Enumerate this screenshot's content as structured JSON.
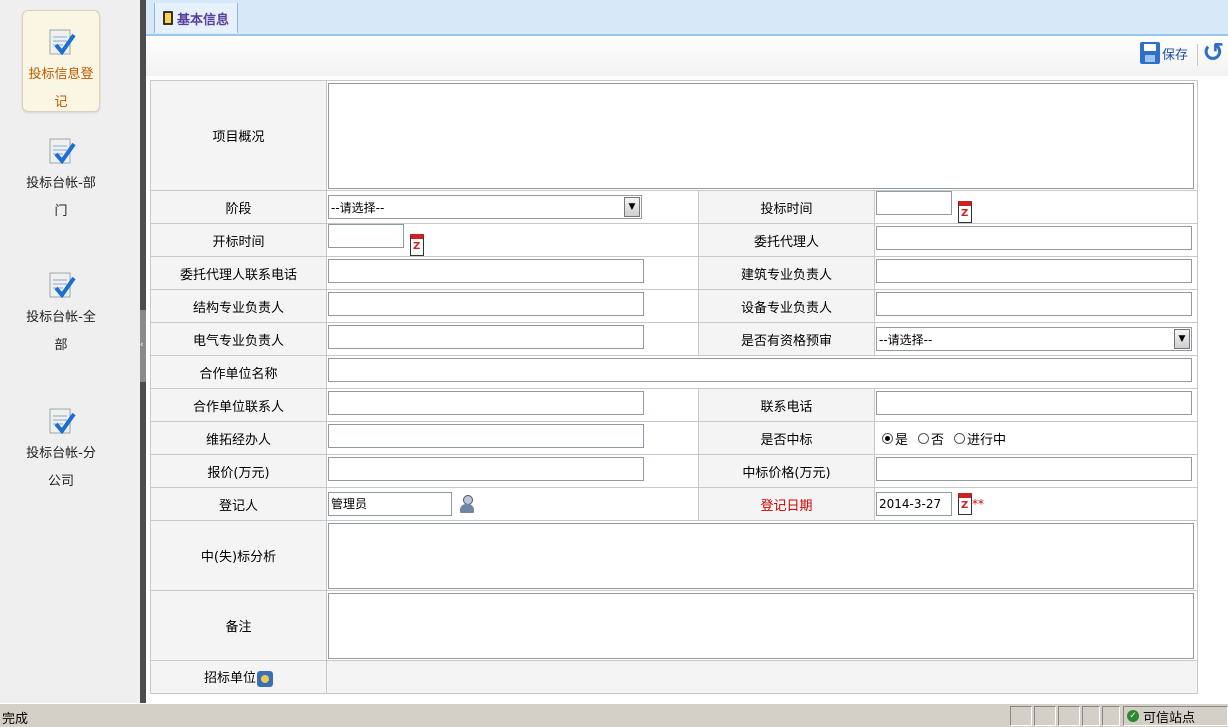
{
  "sidebar": {
    "items": [
      {
        "label": "投标信息登记",
        "active": true
      },
      {
        "label": "投标台帐-部门",
        "active": false
      },
      {
        "label": "投标台帐-全部",
        "active": false
      },
      {
        "label": "投标台帐-分公司",
        "active": false
      }
    ]
  },
  "tab": {
    "label": "基本信息"
  },
  "toolbar": {
    "save_label": "保存"
  },
  "form": {
    "project_overview": "项目概况",
    "stage": "阶段",
    "stage_value": "--请选择--",
    "bid_time": "投标时间",
    "open_time": "开标时间",
    "agent": "委托代理人",
    "agent_phone": "委托代理人联系电话",
    "arch_lead": "建筑专业负责人",
    "struct_lead": "结构专业负责人",
    "equip_lead": "设备专业负责人",
    "elec_lead": "电气专业负责人",
    "prequal": "是否有资格预审",
    "prequal_value": "--请选择--",
    "partner_name": "合作单位名称",
    "partner_contact": "合作单位联系人",
    "contact_phone": "联系电话",
    "maintainer": "维拓经办人",
    "won_bid": "是否中标",
    "won_options": [
      "是",
      "否",
      "进行中"
    ],
    "won_selected": "是",
    "quote": "报价(万元)",
    "won_price": "中标价格(万元)",
    "registrant": "登记人",
    "registrant_value": "管理员",
    "reg_date": "登记日期",
    "reg_date_value": "2014-3-27",
    "required_mark": "**",
    "analysis": "中(失)标分析",
    "notes": "备注",
    "tender_unit": "招标单位"
  },
  "statusbar": {
    "status": "完成",
    "zone": "可信站点"
  },
  "colors": {
    "accent": "#d40000",
    "tab_bg": "#d7e9f8",
    "sidebar_bg": "#efefef"
  }
}
